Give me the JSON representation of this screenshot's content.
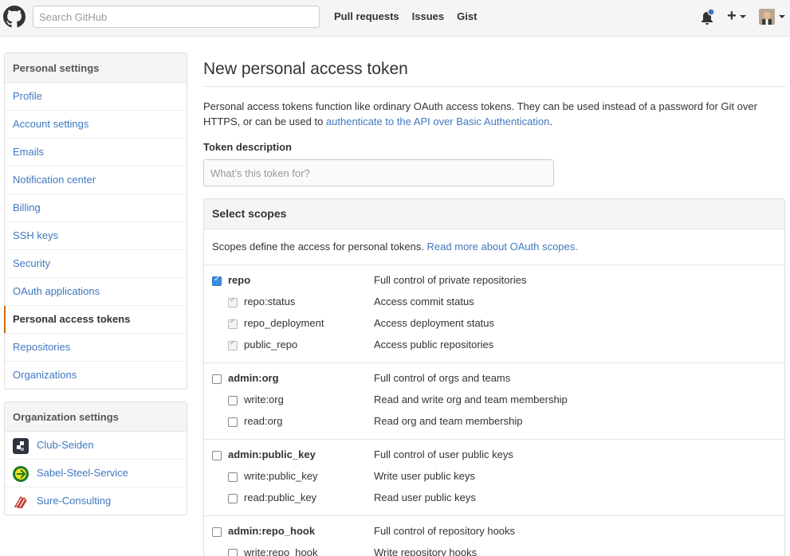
{
  "header": {
    "search_placeholder": "Search GitHub",
    "nav": [
      "Pull requests",
      "Issues",
      "Gist"
    ],
    "notification_dot_color": "#4078c0"
  },
  "sidebar": {
    "personal_heading": "Personal settings",
    "personal_items": [
      {
        "label": "Profile"
      },
      {
        "label": "Account settings"
      },
      {
        "label": "Emails"
      },
      {
        "label": "Notification center"
      },
      {
        "label": "Billing"
      },
      {
        "label": "SSH keys"
      },
      {
        "label": "Security"
      },
      {
        "label": "OAuth applications"
      },
      {
        "label": "Personal access tokens",
        "selected": true
      },
      {
        "label": "Repositories"
      },
      {
        "label": "Organizations"
      }
    ],
    "org_heading": "Organization settings",
    "orgs": [
      {
        "label": "Club-Seiden",
        "icon": "club-seiden-logo-icon"
      },
      {
        "label": "Sabel-Steel-Service",
        "icon": "sabel-steel-logo-icon"
      },
      {
        "label": "Sure-Consulting",
        "icon": "sure-consulting-logo-icon"
      }
    ],
    "accent_color": "#d26911"
  },
  "main": {
    "title": "New personal access token",
    "intro_text": "Personal access tokens function like ordinary OAuth access tokens. They can be used instead of a password for Git over HTTPS, or can be used to ",
    "intro_link": "authenticate to the API over Basic Authentication",
    "intro_end": ".",
    "token_label": "Token description",
    "token_placeholder": "What’s this token for?",
    "scopes_heading": "Select scopes",
    "scopes_note": "Scopes define the access for personal tokens. ",
    "scopes_note_link": "Read more about OAuth scopes.",
    "link_color": "#4078c0",
    "scope_groups": [
      {
        "name": "repo",
        "desc": "Full control of private repositories",
        "checked": true,
        "children": [
          {
            "name": "repo:status",
            "desc": "Access commit status",
            "checked": true
          },
          {
            "name": "repo_deployment",
            "desc": "Access deployment status",
            "checked": true
          },
          {
            "name": "public_repo",
            "desc": "Access public repositories",
            "checked": true
          }
        ]
      },
      {
        "name": "admin:org",
        "desc": "Full control of orgs and teams",
        "checked": false,
        "children": [
          {
            "name": "write:org",
            "desc": "Read and write org and team membership",
            "checked": false
          },
          {
            "name": "read:org",
            "desc": "Read org and team membership",
            "checked": false
          }
        ]
      },
      {
        "name": "admin:public_key",
        "desc": "Full control of user public keys",
        "checked": false,
        "children": [
          {
            "name": "write:public_key",
            "desc": "Write user public keys",
            "checked": false
          },
          {
            "name": "read:public_key",
            "desc": "Read user public keys",
            "checked": false
          }
        ]
      },
      {
        "name": "admin:repo_hook",
        "desc": "Full control of repository hooks",
        "checked": false,
        "children": [
          {
            "name": "write:repo_hook",
            "desc": "Write repository hooks",
            "checked": false
          }
        ]
      }
    ]
  }
}
